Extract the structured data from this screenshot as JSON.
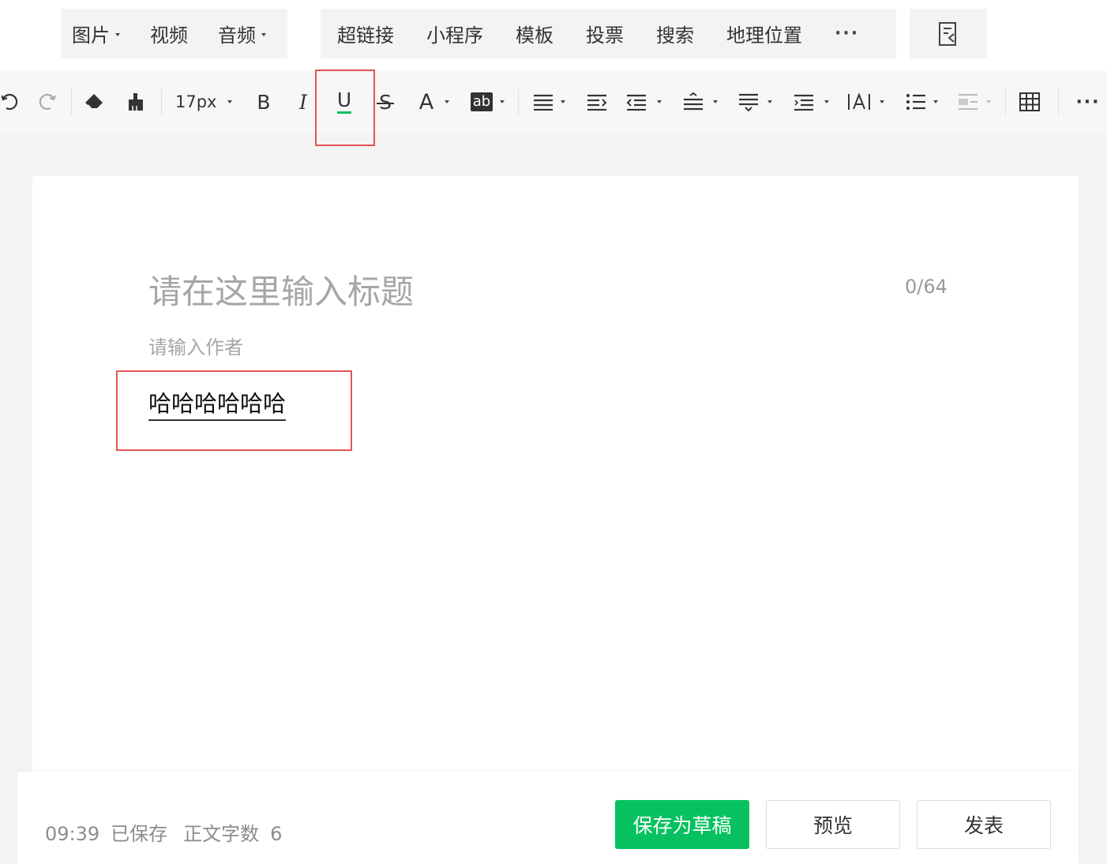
{
  "insert_menu": {
    "group1": [
      {
        "label": "图片",
        "dropdown": true
      },
      {
        "label": "视频",
        "dropdown": false
      },
      {
        "label": "音频",
        "dropdown": true
      }
    ],
    "group2": [
      "超链接",
      "小程序",
      "模板",
      "投票",
      "搜索",
      "地理位置"
    ],
    "more_icon": "ellipsis-icon",
    "doc_import_icon": "document-import-icon"
  },
  "format_toolbar": {
    "font_size": "17px",
    "bold_label": "B",
    "italic_label": "I",
    "underline_label": "U",
    "strikethrough_label": "S",
    "font_color_label": "A",
    "background_color_label": "ab",
    "underline_active_color": "#07c160",
    "icons": [
      "undo-icon",
      "redo-icon",
      "eraser-icon",
      "format-painter-icon",
      "align-icon",
      "indent-icon",
      "outdent-icon",
      "line-height-icon",
      "paragraph-spacing-icon",
      "letter-spacing-icon",
      "letter-spacing-icon",
      "bullet-list-icon",
      "image-align-icon",
      "table-icon",
      "more-icon"
    ]
  },
  "editor": {
    "title_placeholder": "请在这里输入标题",
    "title_counter": "0/64",
    "author_placeholder": "请输入作者",
    "body_text": "哈哈哈哈哈哈"
  },
  "footer": {
    "time": "09:39",
    "saved_status": "已保存",
    "word_count_label": "正文字数",
    "word_count": "6",
    "save_draft_label": "保存为草稿",
    "preview_label": "预览",
    "publish_label": "发表"
  },
  "colors": {
    "primary_green": "#07c160",
    "highlight_red": "#e55454"
  }
}
